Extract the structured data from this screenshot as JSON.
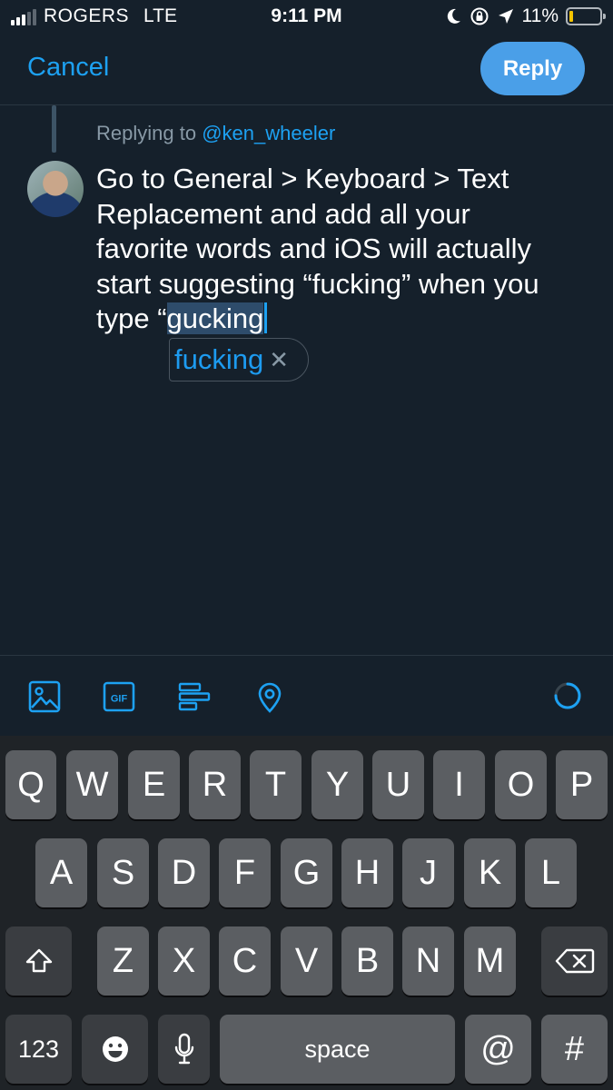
{
  "status_bar": {
    "carrier": "ROGERS",
    "network": "LTE",
    "time": "9:11 PM",
    "battery_percent": "11%",
    "signal_bars_filled": 3,
    "signal_bars_total": 5,
    "battery_level": 0.11,
    "icons": [
      "moon-icon",
      "rotation-lock-icon",
      "location-arrow-icon",
      "battery-icon"
    ]
  },
  "header": {
    "cancel_label": "Cancel",
    "reply_label": "Reply"
  },
  "compose": {
    "replying_prefix": "Replying to",
    "replying_handle": "@ken_wheeler",
    "text_lines": [
      "Go to General > Keyboard > Text",
      "Replacement and add all your",
      "favorite words and iOS will actually",
      "start suggesting “fucking” when you"
    ],
    "last_line_prefix": "type “",
    "selected_word": "gucking",
    "autocorrect_suggestion": "fucking",
    "autocorrect_dismiss": "✕"
  },
  "toolbar": {
    "icons": [
      "image-icon",
      "gif-icon",
      "poll-icon",
      "location-icon"
    ],
    "gif_label": "GIF"
  },
  "keyboard": {
    "row1": [
      "Q",
      "W",
      "E",
      "R",
      "T",
      "Y",
      "U",
      "I",
      "O",
      "P"
    ],
    "row2": [
      "A",
      "S",
      "D",
      "F",
      "G",
      "H",
      "J",
      "K",
      "L"
    ],
    "row3": [
      "Z",
      "X",
      "C",
      "V",
      "B",
      "N",
      "M"
    ],
    "numbers_label": "123",
    "space_label": "space",
    "at_label": "@",
    "hash_label": "#"
  },
  "colors": {
    "background": "#15202b",
    "accent": "#1da1f2",
    "reply_button": "#4a9fe8",
    "keyboard_bg": "#1f2327",
    "key": "#5b5e62",
    "key_dark": "#3a3d41"
  }
}
